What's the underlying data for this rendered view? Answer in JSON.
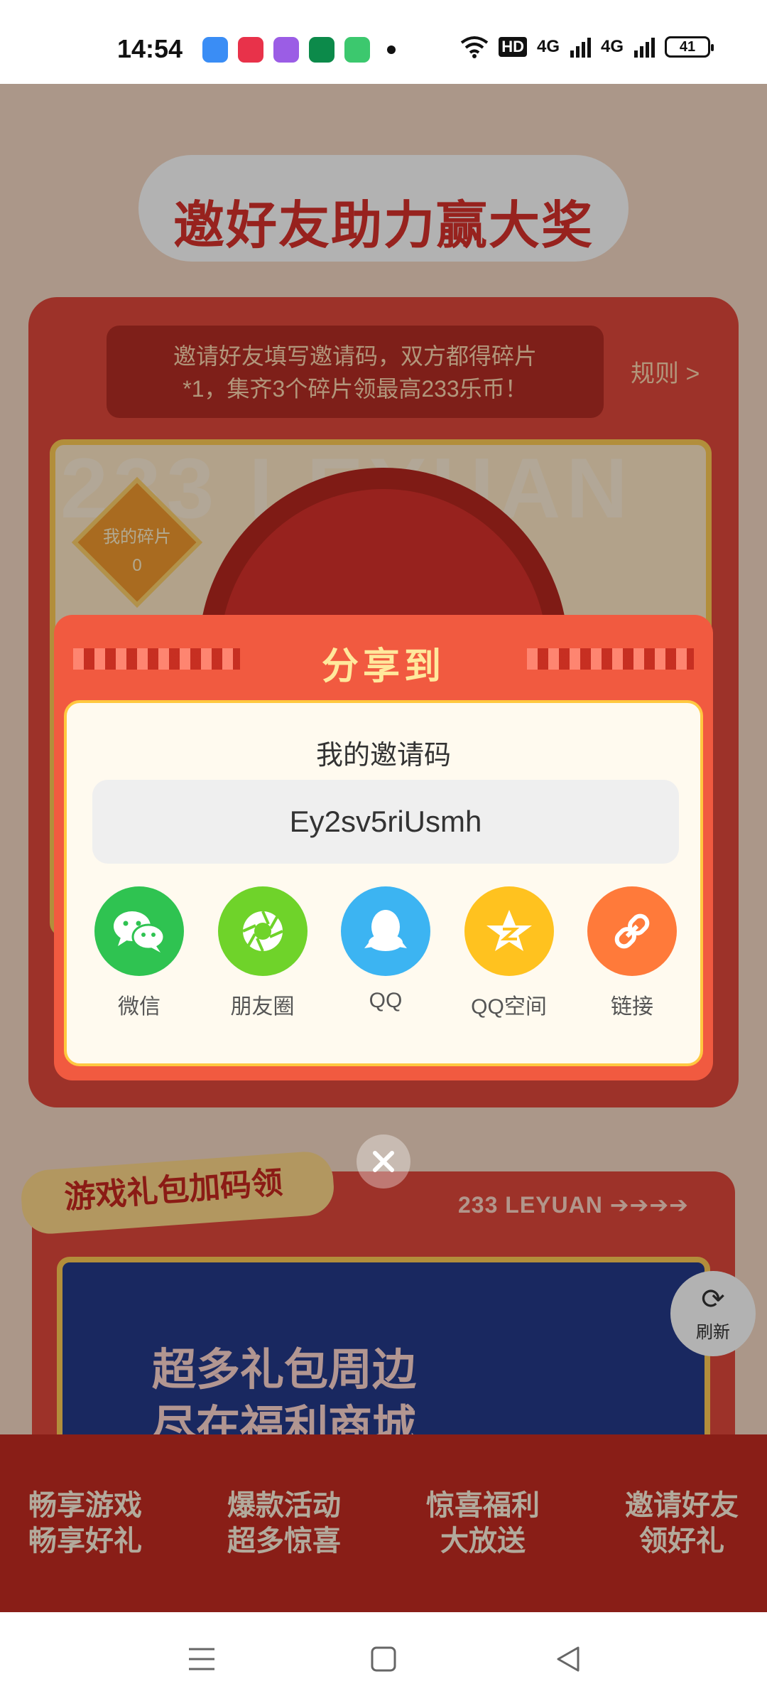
{
  "status_bar": {
    "time": "14:54",
    "network_hd": "HD",
    "signal_1": "4G",
    "signal_2": "4G",
    "battery": "41",
    "app_colors": [
      "#3a8df5",
      "#e8324a",
      "#9b5de5",
      "#0c8a4a",
      "#3cc86e"
    ]
  },
  "background_page": {
    "headline": "邀好友助力赢大奖",
    "invite_desc_line1": "邀请好友填写邀请码，双方都得碎片",
    "invite_desc_line2": "*1，集齐3个碎片领最高233乐币！",
    "rules_link": "规则 >",
    "bg_word": "233 LEYUAN",
    "fragments_label": "我的碎片",
    "fragments_count": "0",
    "gift_title": "游戏礼包加码领",
    "gift_brand": "233 LEYUAN ➔➔➔➔",
    "gift_banner_line1": "超多礼包周边",
    "gift_banner_line2": "尽在福利商城",
    "features": [
      {
        "line1": "畅享游戏",
        "line2": "畅享好礼"
      },
      {
        "line1": "爆款活动",
        "line2": "超多惊喜"
      },
      {
        "line1": "惊喜福利",
        "line2": "大放送"
      },
      {
        "line1": "邀请好友",
        "line2": "领好礼"
      }
    ],
    "refresh_label": "刷新"
  },
  "dialog": {
    "title": "分享到",
    "code_label": "我的邀请码",
    "invite_code": "Ey2sv5riUsmh",
    "share_options": [
      {
        "label": "微信",
        "icon": "wechat-icon",
        "color": "#2fc351"
      },
      {
        "label": "朋友圈",
        "icon": "moments-icon",
        "color": "#6fd32a"
      },
      {
        "label": "QQ",
        "icon": "qq-icon",
        "color": "#3cb4f2"
      },
      {
        "label": "QQ空间",
        "icon": "qzone-icon",
        "color": "#ffc21f"
      },
      {
        "label": "链接",
        "icon": "link-icon",
        "color": "#ff7a3a"
      }
    ]
  },
  "nav_bar": {
    "menu": "menu-icon",
    "home": "home-icon",
    "back": "back-icon"
  }
}
